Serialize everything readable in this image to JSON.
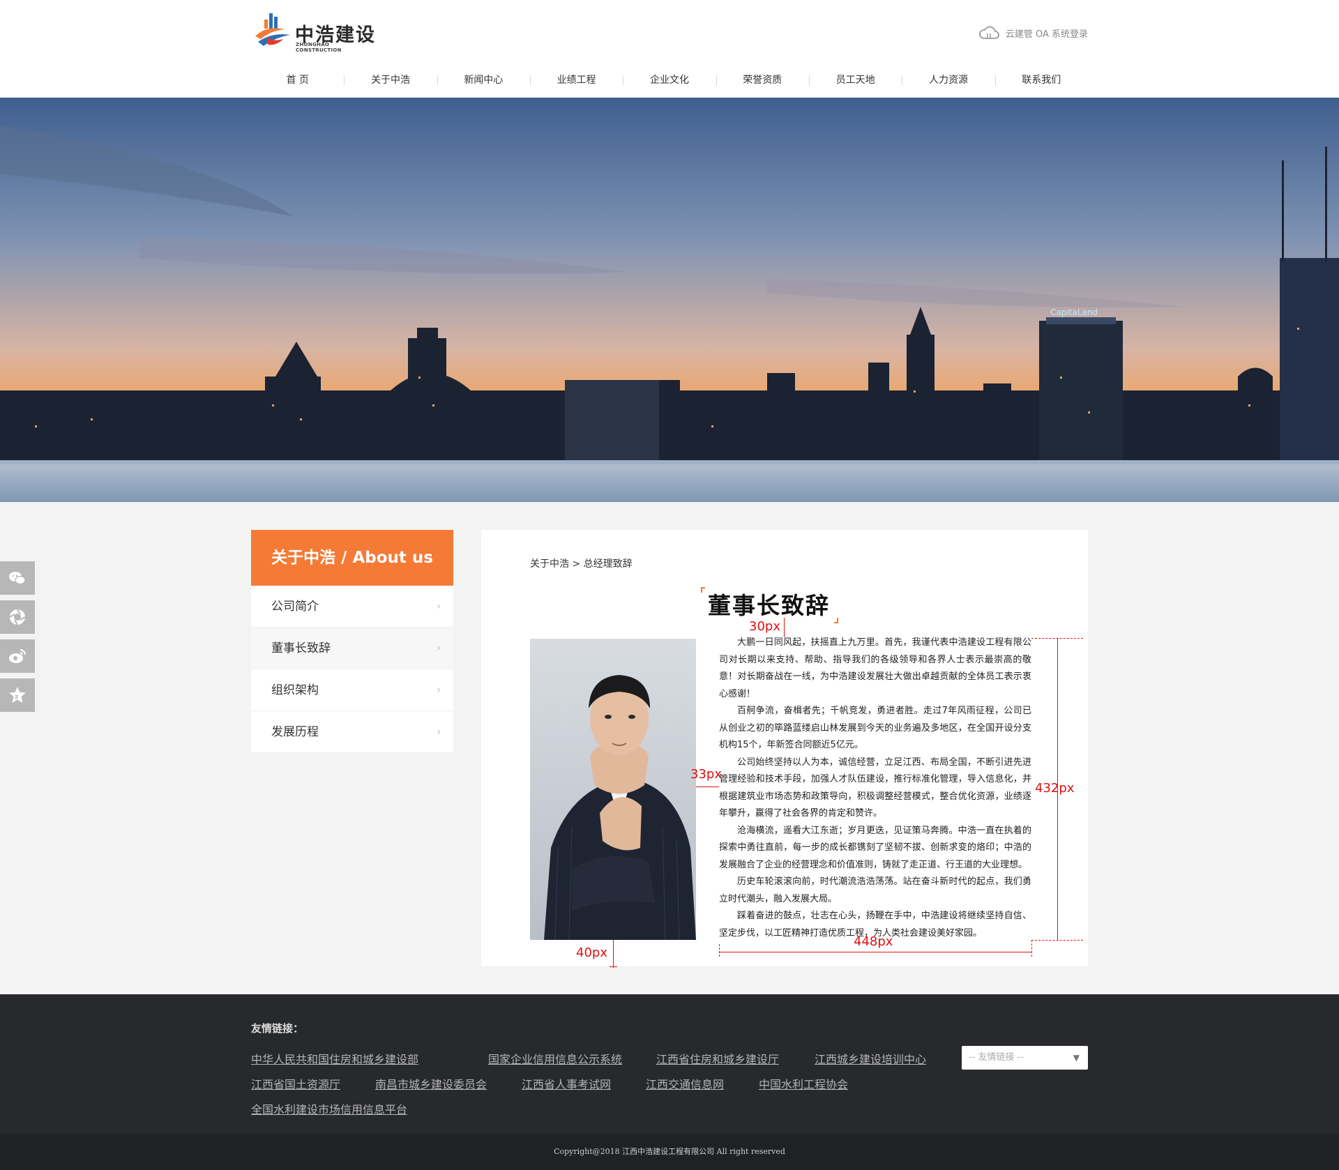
{
  "header": {
    "logo_cn": "中浩建设",
    "logo_en": "ZHONGHAO CONSTRUCTION",
    "oa_label": "云建管 OA 系统登录",
    "nav": [
      "首 页",
      "关于中浩",
      "新闻中心",
      "业绩工程",
      "企业文化",
      "荣誉资质",
      "员工天地",
      "人力资源",
      "联系我们"
    ]
  },
  "banner": {
    "sign": "CapitaLand"
  },
  "float_tools": [
    "wechat-icon",
    "camera-icon",
    "weibo-icon",
    "star-icon"
  ],
  "side": {
    "title": "关于中浩 / About us",
    "items": [
      {
        "label": "公司简介"
      },
      {
        "label": "董事长致辞"
      },
      {
        "label": "组织架构"
      },
      {
        "label": "发展历程"
      }
    ],
    "active_index": 1,
    "arrow": "›"
  },
  "main": {
    "breadcrumb": "关于中浩 > 总经理致辞",
    "title": "董事长致辞",
    "paragraphs": [
      "大鹏一日同风起，扶摇直上九万里。首先，我谨代表中浩建设工程有限公司对长期以来支持、帮助、指导我们的各级领导和各界人士表示最崇高的敬意！对长期奋战在一线，为中浩建设发展壮大做出卓越贡献的全体员工表示衷心感谢！",
      "百舸争流，奋楫者先；千帆竞发，勇进者胜。走过7年风雨征程，公司已从创业之初的筚路蓝缕启山林发展到今天的业务遍及多地区，在全国开设分支机构15个，年新签合同额近5亿元。",
      "公司始终坚持以人为本，诚信经营，立足江西、布局全国，不断引进先进管理经验和技术手段，加强人才队伍建设，推行标准化管理，导入信息化，并根据建筑业市场态势和政策导向，积极调整经营模式，整合优化资源，业绩逐年攀升，赢得了社会各界的肯定和赞许。",
      "沧海横流，遥看大江东逝；岁月更迭，见证策马奔腾。中浩一直在执着的探索中勇往直前，每一步的成长都镌刻了坚韧不拔、创新求变的烙印；中浩的发展融合了企业的经营理念和价值准则，铸就了走正道、行王道的大业理想。",
      "历史车轮滚滚向前，时代潮流浩浩荡荡。站在奋斗新时代的起点，我们勇立时代潮头，融入发展大局。",
      "踩着奋进的鼓点，壮志在心头，扬鞭在手中，中浩建设将继续坚持自信、坚定步伐，以工匠精神打造优质工程，为人类社会建设美好家园。"
    ]
  },
  "annotations": {
    "a30": "30px",
    "a33": "33px",
    "a432": "432px",
    "a40": "40px",
    "a448": "448px"
  },
  "footer": {
    "title": "友情链接：",
    "links": [
      "中华人民共和国住房和城乡建设部",
      "国家企业信用信息公示系统",
      "江西省住房和城乡建设厅",
      "江西城乡建设培训中心",
      "江西省国土资源厅",
      "南昌市城乡建设委员会",
      "江西省人事考试网",
      "江西交通信息网",
      "中国水利工程协会",
      "全国水利建设市场信用信息平台"
    ],
    "select_placeholder": "-- 友情链接 --",
    "caret": "▼",
    "copyright": "Copyright@2018 江西中浩建设工程有限公司 All right reserved"
  },
  "colors": {
    "accent": "#f57a35",
    "footer_bg": "#27292c",
    "annotation": "#e01010"
  }
}
